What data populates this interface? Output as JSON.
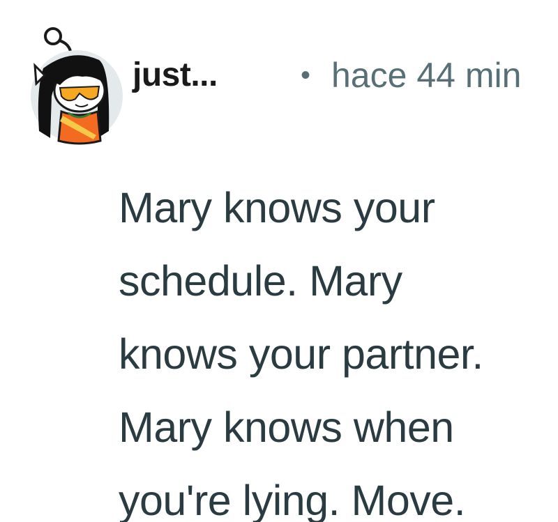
{
  "comment": {
    "avatar_icon": "snoo-avatar-icon",
    "username": "just...",
    "separator": "•",
    "timestamp": "hace 44 min",
    "body_lines": [
      "Mary knows your",
      "schedule. Mary",
      "knows your partner.",
      "Mary knows when",
      "you're lying. Move."
    ]
  }
}
